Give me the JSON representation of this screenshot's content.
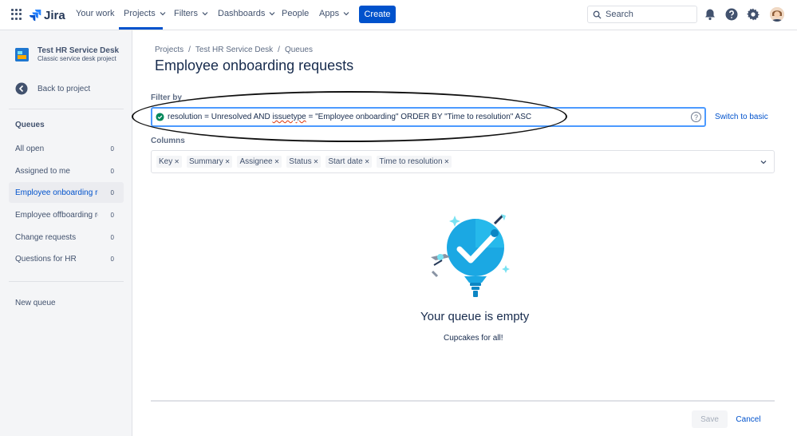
{
  "topnav": {
    "logo_text": "Jira",
    "items": [
      {
        "label": "Your work"
      },
      {
        "label": "Projects"
      },
      {
        "label": "Filters"
      },
      {
        "label": "Dashboards"
      },
      {
        "label": "People"
      },
      {
        "label": "Apps"
      }
    ],
    "create_label": "Create",
    "search_placeholder": "Search",
    "accent_color": "#0052cc"
  },
  "sidebar": {
    "project_name": "Test HR Service Desk",
    "project_type": "Classic service desk project",
    "back_label": "Back to project",
    "queues_heading": "Queues",
    "queues": [
      {
        "label": "All open",
        "count": "0"
      },
      {
        "label": "Assigned to me",
        "count": "0"
      },
      {
        "label": "Employee onboarding requests",
        "count": "0",
        "selected": true
      },
      {
        "label": "Employee offboarding requests",
        "count": "0"
      },
      {
        "label": "Change requests",
        "count": "0"
      },
      {
        "label": "Questions for HR",
        "count": "0"
      }
    ],
    "new_queue_label": "New queue"
  },
  "breadcrumb": [
    "Projects",
    "Test HR Service Desk",
    "Queues"
  ],
  "page_title": "Employee onboarding requests",
  "filter": {
    "label": "Filter by",
    "jql_before": "resolution = Unresolved AND ",
    "jql_underlined": "issuetype",
    "jql_after": " = \"Employee onboarding\" ORDER BY \"Time to resolution\" ASC",
    "help_glyph": "?",
    "switch_label": "Switch to basic"
  },
  "columns": {
    "label": "Columns",
    "chips": [
      "Key",
      "Summary",
      "Assignee",
      "Status",
      "Start date",
      "Time to resolution"
    ]
  },
  "empty_state": {
    "title": "Your queue is empty",
    "subtitle": "Cupcakes for all!"
  },
  "footer": {
    "save_label": "Save",
    "cancel_label": "Cancel"
  }
}
